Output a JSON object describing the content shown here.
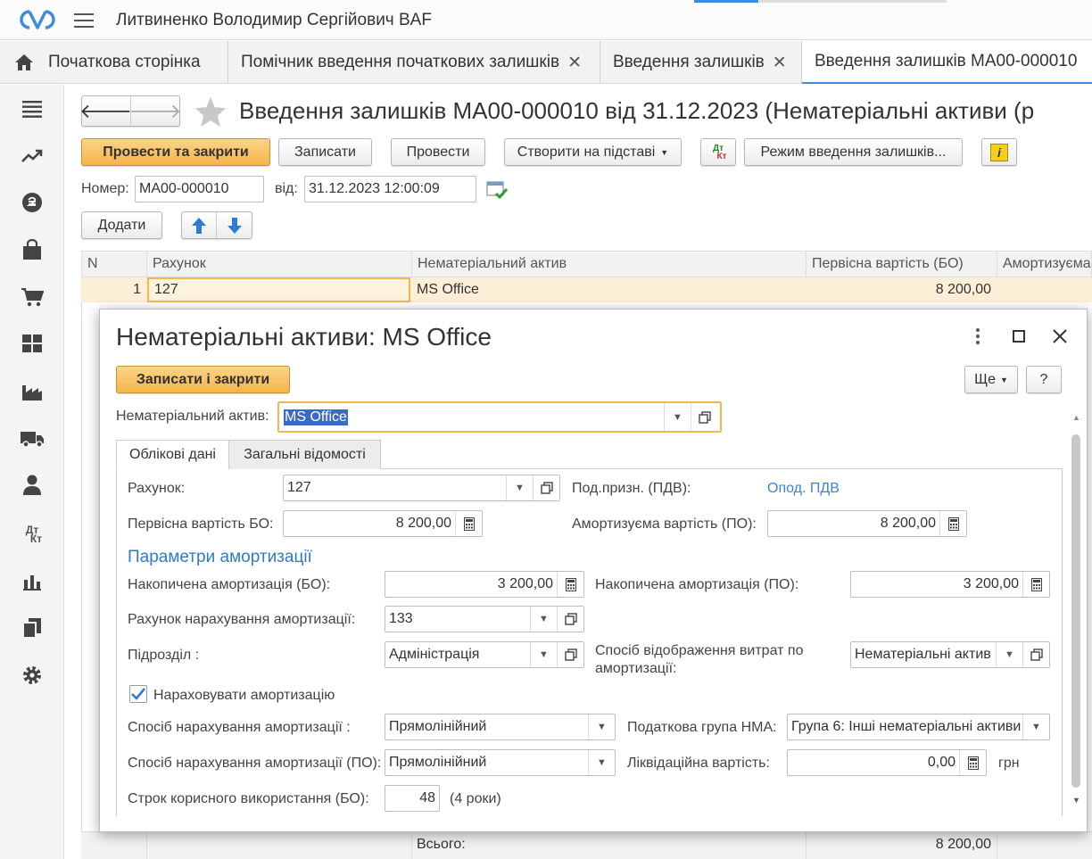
{
  "header": {
    "user": "Литвиненко Володимир Сергійович BAF"
  },
  "tabs": [
    {
      "label": "Початкова сторінка"
    },
    {
      "label": "Помічник введення початкових залишків"
    },
    {
      "label": "Введення залишків"
    },
    {
      "label": "Введення залишків МА00-000010"
    }
  ],
  "doc": {
    "title": "Введення залишків МА00-000010 від 31.12.2023 (Нематеріальні активи (р",
    "buttons": {
      "post_close": "Провести та закрити",
      "save": "Записати",
      "post": "Провести",
      "create_based": "Створити на підставі",
      "dtkt": "Дт Кт",
      "mode": "Режим введення залишків...",
      "add": "Додати"
    },
    "number_label": "Номер:",
    "number_value": "МА00-000010",
    "date_label": "від:",
    "date_value": "31.12.2023 12:00:09"
  },
  "table": {
    "columns": [
      "N",
      "Рахунок",
      "Нематеріальний актив",
      "Первісна вартість (БО)",
      "Амортизуєма"
    ],
    "rows": [
      {
        "n": "1",
        "account": "127",
        "asset": "MS Office",
        "cost": "8 200,00"
      }
    ],
    "total_label": "Всього:",
    "total_value": "8 200,00"
  },
  "modal": {
    "title": "Нематеріальні активи: MS Office",
    "save_close": "Записати і закрити",
    "more": "Ще",
    "help": "?",
    "asset_label": "Нематеріальний актив:",
    "asset_value": "MS Office",
    "tab_accounting": "Облікові дані",
    "tab_general": "Загальні відомості",
    "account_label": "Рахунок:",
    "account_value": "127",
    "vat_label": "Под.призн. (ПДВ):",
    "vat_link": "Опод. ПДВ",
    "cost_bo_label": "Первісна вартість БО:",
    "cost_bo_value": "8 200,00",
    "amort_cost_label": "Амортизуєма вартість (ПО):",
    "amort_cost_value": "8 200,00",
    "section_title": "Параметри амортизації",
    "acc_amort_bo_label": "Накопичена амортизація (БО):",
    "acc_amort_bo_value": "3 200,00",
    "acc_amort_po_label": "Накопичена амортизація (ПО):",
    "acc_amort_po_value": "3 200,00",
    "amort_account_label": "Рахунок нарахування амортизації:",
    "amort_account_value": "133",
    "division_label": "Підрозділ :",
    "division_value": "Адміністрація",
    "expense_label_1": "Спосіб відображення витрат по",
    "expense_label_2": "амортизації:",
    "expense_value": "Нематеріальні актив",
    "charge_amort_label": "Нараховувати амортизацію",
    "method_label": "Спосіб нарахування амортизації :",
    "method_value": "Прямолінійний",
    "tax_group_label": "Податкова група НМА:",
    "tax_group_value": "Група 6: Інші нематеріальні активи",
    "method_po_label": "Спосіб нарахування амортизації (ПО):",
    "method_po_value": "Прямолінійний",
    "liquid_label": "Ліквідаційна вартість:",
    "liquid_value": "0,00",
    "currency": "грн",
    "life_label": "Строк корисного використання (БО):",
    "life_value": "48",
    "life_hint": "(4 роки)"
  },
  "colors": {
    "accent": "#3f8dd8",
    "primary_button": "#f4b44a",
    "link": "#3f85c8",
    "selected_row": "#fcefd8"
  }
}
